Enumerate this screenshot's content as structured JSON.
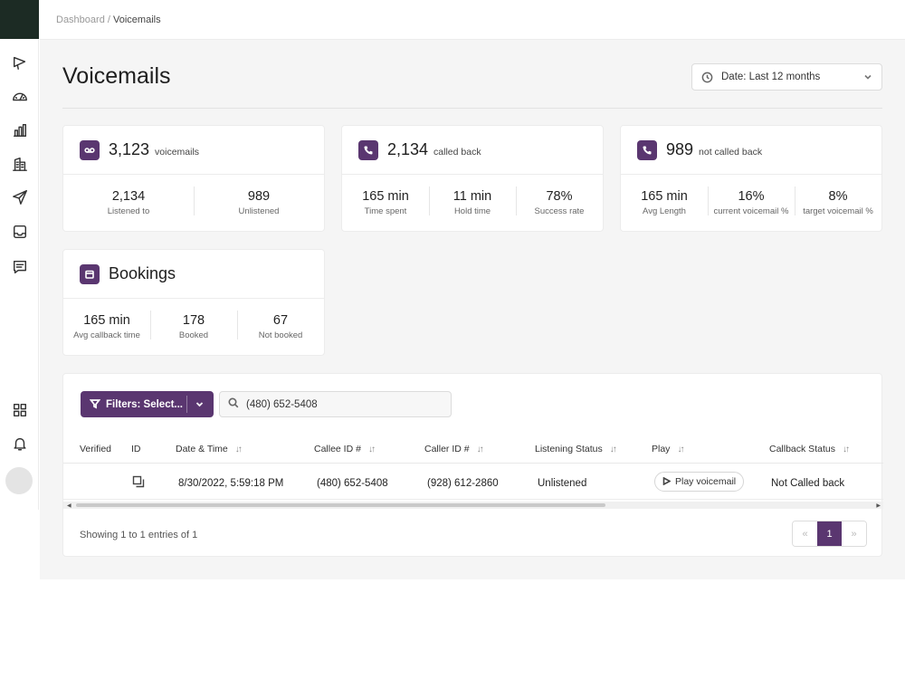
{
  "breadcrumb": {
    "parent": "Dashboard",
    "separator": " / ",
    "current": "Voicemails"
  },
  "page": {
    "title": "Voicemails"
  },
  "date_filter": {
    "label": "Date: Last 12 months"
  },
  "sidebar": {
    "icons": [
      "megaphone-icon",
      "speedometer-icon",
      "bar-chart-icon",
      "buildings-icon",
      "send-icon",
      "inbox-icon",
      "message-icon",
      "grid-icon",
      "bell-icon"
    ]
  },
  "cards": {
    "voicemails": {
      "value": "3,123",
      "unit": "voicemails",
      "metrics": [
        {
          "value": "2,134",
          "label": "Listened to"
        },
        {
          "value": "989",
          "label": "Unlistened"
        }
      ]
    },
    "called_back": {
      "value": "2,134",
      "unit": "called back",
      "metrics": [
        {
          "value": "165 min",
          "label": "Time spent"
        },
        {
          "value": "11 min",
          "label": "Hold time"
        },
        {
          "value": "78%",
          "label": "Success rate"
        }
      ]
    },
    "not_called_back": {
      "value": "989",
      "unit": "not called back",
      "metrics": [
        {
          "value": "165 min",
          "label": "Avg Length"
        },
        {
          "value": "16%",
          "label": "current voicemail %"
        },
        {
          "value": "8%",
          "label": "target voicemail %"
        }
      ]
    },
    "bookings": {
      "title": "Bookings",
      "metrics": [
        {
          "value": "165 min",
          "label": "Avg callback time"
        },
        {
          "value": "178",
          "label": "Booked"
        },
        {
          "value": "67",
          "label": "Not booked"
        }
      ]
    }
  },
  "table": {
    "filters_label": "Filters: Select...",
    "search_value": "(480) 652-5408",
    "columns": [
      "Verified",
      "ID",
      "Date & Time",
      "Callee ID #",
      "Caller ID #",
      "Listening Status",
      "Play",
      "Callback Status"
    ],
    "sort_glyph": "↓↑",
    "rows": [
      {
        "verified": "",
        "date_time": "8/30/2022, 5:59:18 PM",
        "callee_id": "(480) 652-5408",
        "caller_id": "(928) 612-2860",
        "listening_status": "Unlistened",
        "play_label": "Play voicemail",
        "callback_status": "Not Called back"
      }
    ],
    "showing": "Showing 1 to 1 entries of 1",
    "pagination": {
      "prev": "«",
      "current": "1",
      "next": "»"
    }
  },
  "colors": {
    "accent": "#5a3670",
    "sidebar_logo": "#1c2b24",
    "background": "#f5f5f5"
  }
}
